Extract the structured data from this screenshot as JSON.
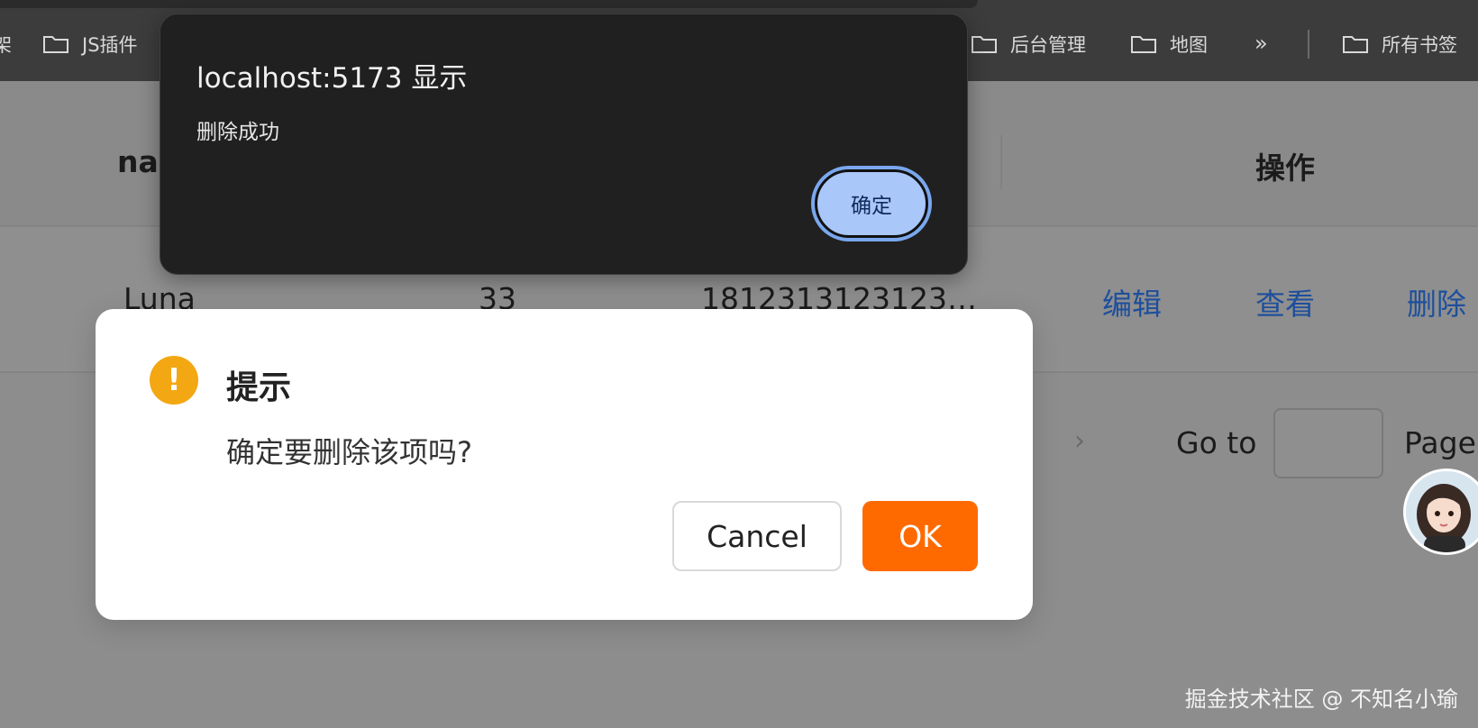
{
  "bookmarks_bar": {
    "items": [
      {
        "label": "架",
        "icon": "folder-icon"
      },
      {
        "label": "JS插件",
        "icon": "folder-icon"
      },
      {
        "label": "后台管理",
        "icon": "folder-icon"
      },
      {
        "label": "地图",
        "icon": "folder-icon"
      },
      {
        "label": "所有书签",
        "icon": "folder-icon"
      }
    ],
    "overflow_label": "»"
  },
  "table": {
    "headers": {
      "name": "nar",
      "actions": "操作"
    },
    "row": {
      "name": "Luna",
      "age": "33",
      "phone": "1812313123123…",
      "actions": {
        "edit": "编辑",
        "view": "查看",
        "delete": "删除"
      }
    },
    "link_color": "#1e4f9c"
  },
  "pagination": {
    "next_symbol": "›",
    "goto_label": "Go to",
    "goto_value": "",
    "page_label": "Page"
  },
  "browser_alert": {
    "title": "localhost:5173 显示",
    "message": "删除成功",
    "ok_label": "确定"
  },
  "confirm_box": {
    "icon": "warning-icon",
    "icon_glyph": "!",
    "icon_color": "#f3a712",
    "title": "提示",
    "message": "确定要删除该项吗?",
    "cancel_label": "Cancel",
    "ok_label": "OK",
    "ok_color": "#ff6a00"
  },
  "watermark": "掘金技术社区 @ 不知名小瑜"
}
